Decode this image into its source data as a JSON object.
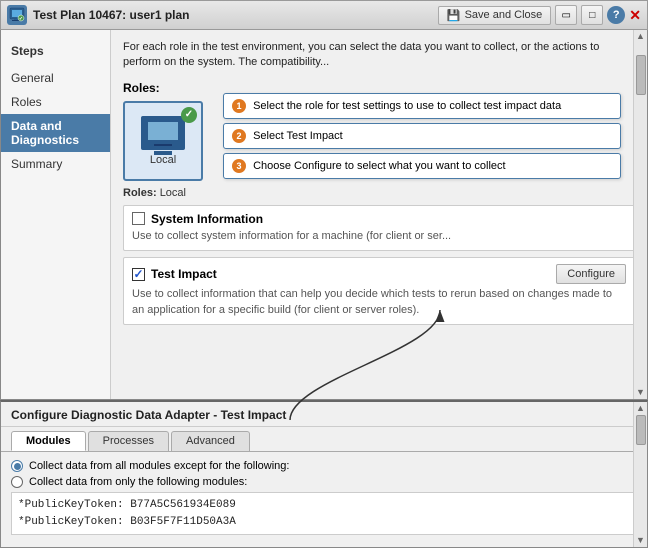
{
  "title_bar": {
    "icon": "TP",
    "title": "Test Plan 10467: user1 plan",
    "save_close_label": "Save and Close",
    "help_label": "?",
    "close_label": "✕"
  },
  "sidebar": {
    "title": "Steps",
    "items": [
      {
        "id": "general",
        "label": "General"
      },
      {
        "id": "roles",
        "label": "Roles"
      },
      {
        "id": "data-diagnostics",
        "label": "Data and Diagnostics"
      },
      {
        "id": "summary",
        "label": "Summary"
      }
    ],
    "active": "data-diagnostics"
  },
  "content": {
    "intro": "For each role in the test environment, you can select the data you want to collect, or the actions to perform on the system. The compatibility...",
    "roles_label": "Roles:",
    "roles": [
      {
        "name": "Local",
        "checked": true
      }
    ],
    "roles_selected_label": "Roles:",
    "roles_selected_value": "Local",
    "callouts": [
      {
        "number": "1",
        "text": "Select the role for test settings to use to collect test impact data"
      },
      {
        "number": "2",
        "text": "Select Test Impact"
      },
      {
        "number": "3",
        "text": "Choose Configure to select what you want to collect"
      }
    ],
    "items": [
      {
        "id": "system-info",
        "checked": false,
        "label": "System Information",
        "desc": "Use to collect system information for a machine (for client or ser..."
      },
      {
        "id": "test-impact",
        "checked": true,
        "label": "Test Impact",
        "desc": "Use to collect information that can help you decide which tests to rerun based on changes made to an application for a specific build (for client or server roles).",
        "has_configure": true,
        "configure_label": "Configure"
      }
    ]
  },
  "bottom_panel": {
    "title": "Configure Diagnostic Data Adapter - Test Impact",
    "tabs": [
      {
        "id": "modules",
        "label": "Modules",
        "active": true
      },
      {
        "id": "processes",
        "label": "Processes",
        "active": false
      },
      {
        "id": "advanced",
        "label": "Advanced",
        "active": false
      }
    ],
    "radio_options": [
      {
        "id": "exclude",
        "label": "Collect data from all modules except for the following:",
        "selected": true
      },
      {
        "id": "include",
        "label": "Collect data from only the following modules:",
        "selected": false
      }
    ],
    "tokens": [
      "*PublicKeyToken: B77A5C561934E089",
      "*PublicKeyToken: B03F5F7F11D50A3A"
    ]
  }
}
